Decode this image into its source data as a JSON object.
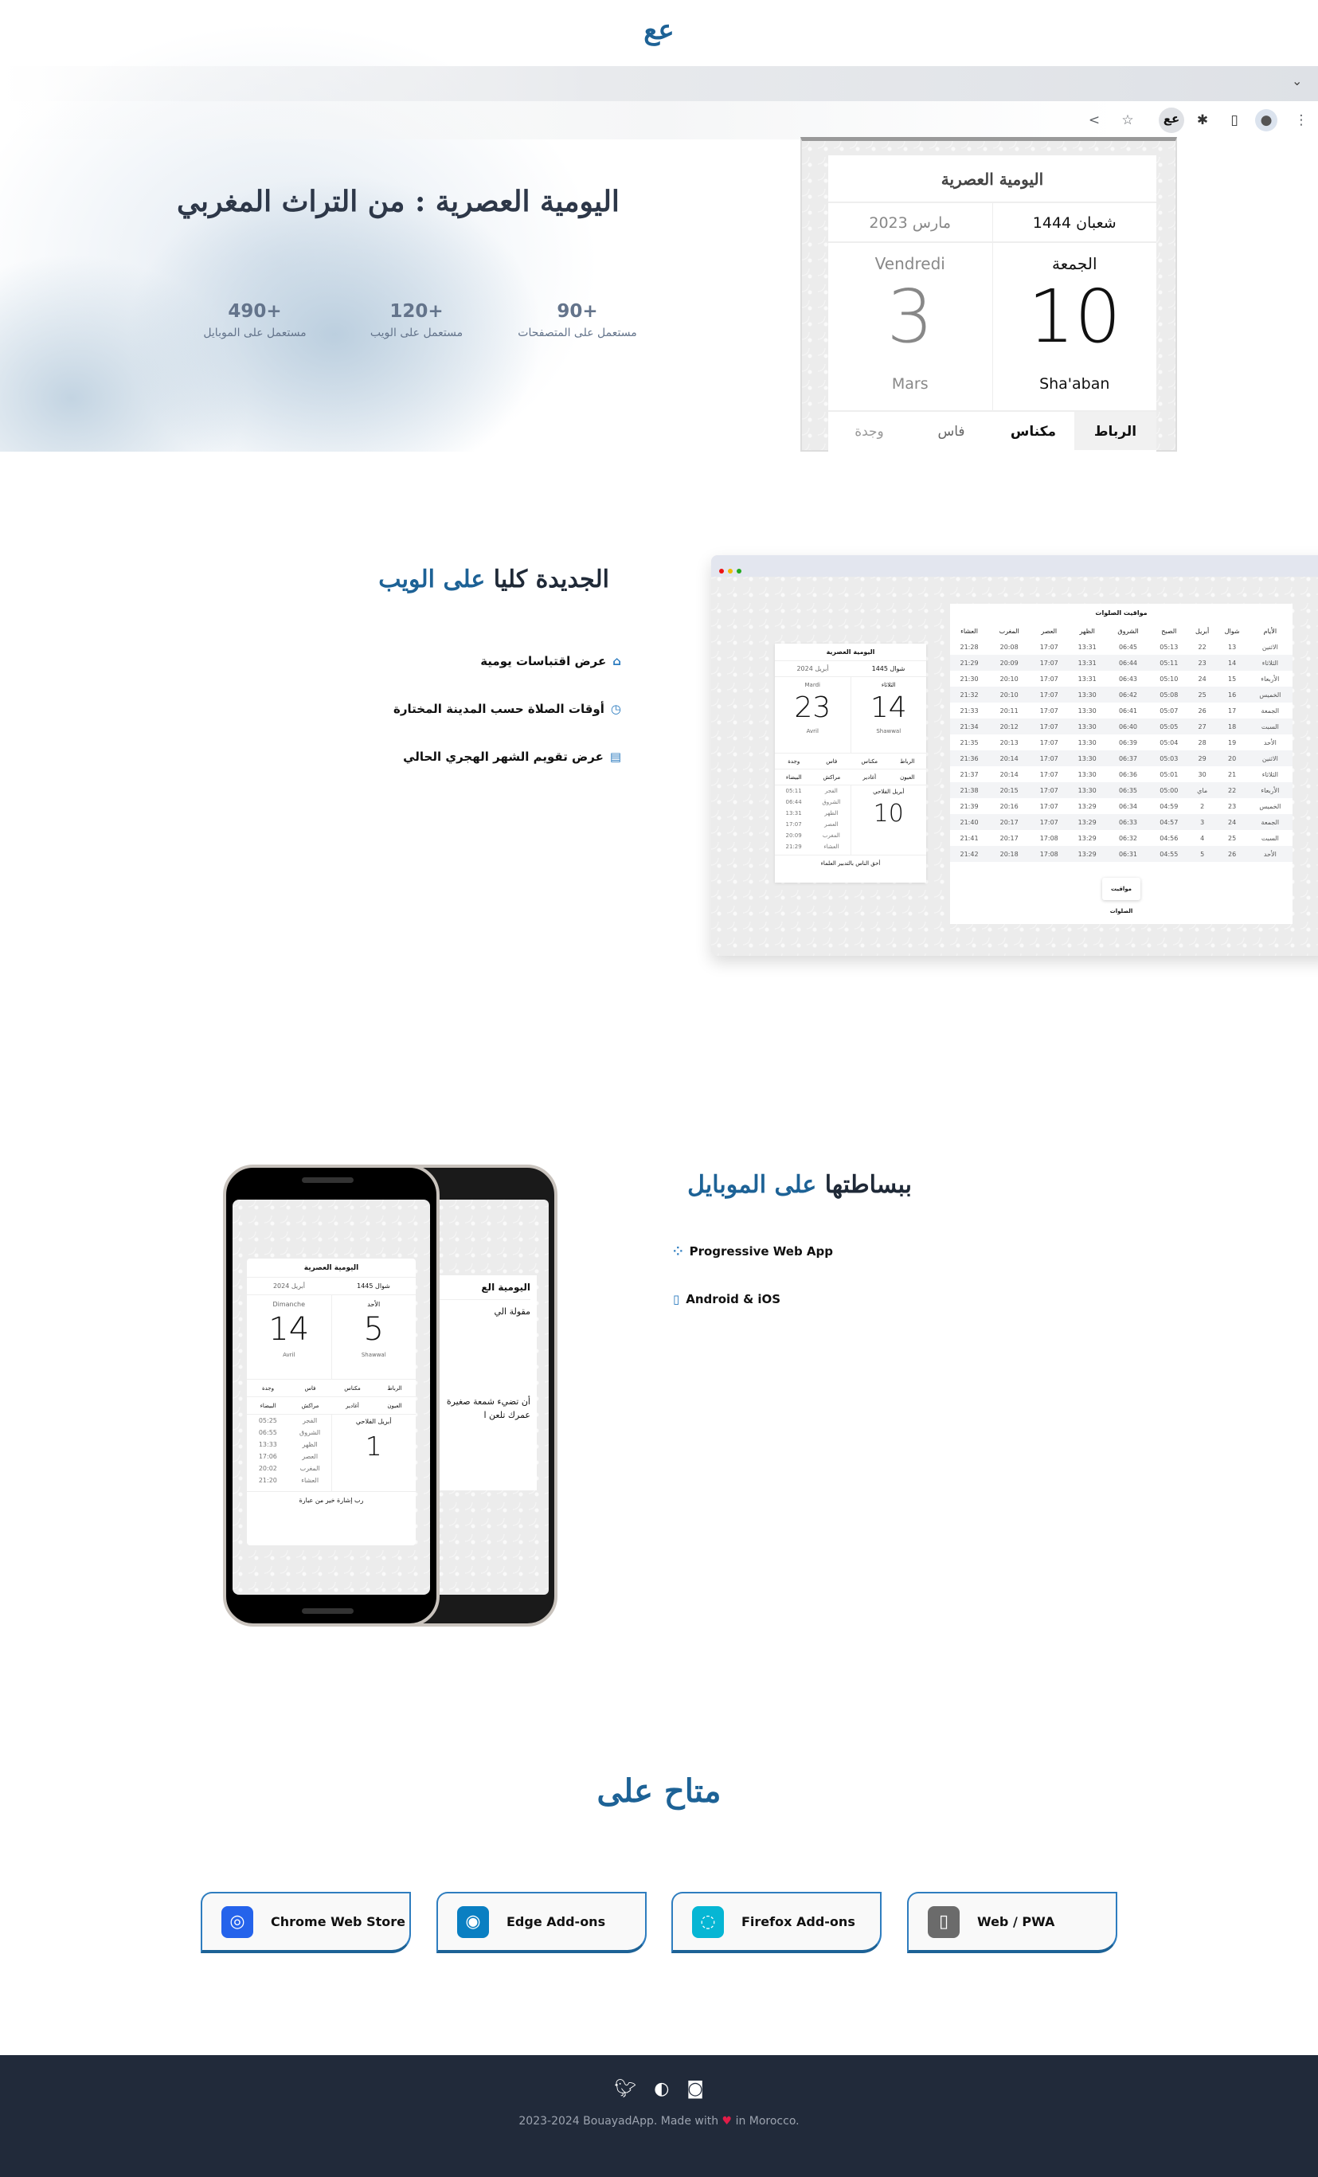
{
  "logo": "ﻋﻊ",
  "hero": {
    "title": "اليومية العصرية : من التراث المغربي",
    "stats": [
      {
        "value": "90+",
        "label": "مستعمل على المتصفحات"
      },
      {
        "value": "120+",
        "label": "مستعمل على الويب"
      },
      {
        "value": "490+",
        "label": "مستعمل على الموبايل"
      }
    ],
    "popup": {
      "title": "اليومية العصرية",
      "hijri": "شعبان 1444",
      "greg": "مارس 2023",
      "day_ar": "الجمعة",
      "day_fr": "Vendredi",
      "hijri_day": "10",
      "greg_day": "3",
      "hijri_month": "Sha'aban",
      "greg_month": "Mars",
      "cities": [
        "الرباط",
        "مكناس",
        "فاس",
        "وجدة"
      ]
    }
  },
  "browser_icons": [
    "share-icon",
    "star-icon",
    "extension-logo-icon",
    "puzzle-icon",
    "sidepanel-icon",
    "profile-icon",
    "menu-icon"
  ],
  "web": {
    "title_dark": "الجديدة كليا",
    "title_blue": "على الويب",
    "features": [
      {
        "icon": "inbox-icon",
        "label": "عرض اقتباسات يومية"
      },
      {
        "icon": "clock-icon",
        "label": "أوقات الصلاة حسب المدينة المختارة"
      },
      {
        "icon": "calendar-icon",
        "label": "عرض تقويم الشهر الهجري الحالي"
      }
    ],
    "card": {
      "title": "اليومية العصرية",
      "hijri": "شوال 1445",
      "greg": "أبريل 2024",
      "day_ar": "الثلاثاء",
      "day_fr": "Mardi",
      "hijri_day": "14",
      "greg_day": "23",
      "hijri_month": "Shawwal",
      "greg_month": "Avril",
      "cities1": [
        "الرباط",
        "مكناس",
        "فاس",
        "وجدة"
      ],
      "cities2": [
        "العيون",
        "أغادير",
        "مراكش",
        "البيضاء"
      ],
      "agri_label": "أبريل الفلاحي",
      "agri_day": "10",
      "prayers": [
        {
          "name": "الفجر",
          "time": "05:11"
        },
        {
          "name": "الشروق",
          "time": "06:44"
        },
        {
          "name": "الظهر",
          "time": "13:31"
        },
        {
          "name": "العصر",
          "time": "17:07"
        },
        {
          "name": "المغرب",
          "time": "20:09"
        },
        {
          "name": "العشاء",
          "time": "21:29"
        }
      ],
      "quote": "أحق الناس بالتدبير العلماء"
    },
    "table": {
      "title": "مواقيت الصلوات",
      "button": "مواقيت الصلوات",
      "headers": [
        "الأيام",
        "شوال",
        "أبريل",
        "الصبح",
        "الشروق",
        "الظهر",
        "العصر",
        "المغرب",
        "العشاء"
      ],
      "rows": [
        [
          "الاثنين",
          "13",
          "22",
          "05:13",
          "06:45",
          "13:31",
          "17:07",
          "20:08",
          "21:28"
        ],
        [
          "الثلاثاء",
          "14",
          "23",
          "05:11",
          "06:44",
          "13:31",
          "17:07",
          "20:09",
          "21:29"
        ],
        [
          "الأربعاء",
          "15",
          "24",
          "05:10",
          "06:43",
          "13:31",
          "17:07",
          "20:10",
          "21:30"
        ],
        [
          "الخميس",
          "16",
          "25",
          "05:08",
          "06:42",
          "13:30",
          "17:07",
          "20:10",
          "21:32"
        ],
        [
          "الجمعة",
          "17",
          "26",
          "05:07",
          "06:41",
          "13:30",
          "17:07",
          "20:11",
          "21:33"
        ],
        [
          "السبت",
          "18",
          "27",
          "05:05",
          "06:40",
          "13:30",
          "17:07",
          "20:12",
          "21:34"
        ],
        [
          "الأحد",
          "19",
          "28",
          "05:04",
          "06:39",
          "13:30",
          "17:07",
          "20:13",
          "21:35"
        ],
        [
          "الاثنين",
          "20",
          "29",
          "05:03",
          "06:37",
          "13:30",
          "17:07",
          "20:14",
          "21:36"
        ],
        [
          "الثلاثاء",
          "21",
          "30",
          "05:01",
          "06:36",
          "13:30",
          "17:07",
          "20:14",
          "21:37"
        ],
        [
          "الأربعاء",
          "22",
          "ماي",
          "05:00",
          "06:35",
          "13:30",
          "17:07",
          "20:15",
          "21:38"
        ],
        [
          "الخميس",
          "23",
          "2",
          "04:59",
          "06:34",
          "13:29",
          "17:07",
          "20:16",
          "21:39"
        ],
        [
          "الجمعة",
          "24",
          "3",
          "04:57",
          "06:33",
          "13:29",
          "17:07",
          "20:17",
          "21:40"
        ],
        [
          "السبت",
          "25",
          "4",
          "04:56",
          "06:32",
          "13:29",
          "17:08",
          "20:17",
          "21:41"
        ],
        [
          "الأحد",
          "26",
          "5",
          "04:55",
          "06:31",
          "13:29",
          "17:08",
          "20:18",
          "21:42"
        ]
      ]
    }
  },
  "mobile": {
    "title_dark": "ببساطتها",
    "title_blue": "على الموبايل",
    "features": [
      {
        "icon": "pwa-icon",
        "label": "Progressive Web App"
      },
      {
        "icon": "phone-icon",
        "label": "Android & iOS"
      }
    ],
    "card": {
      "title": "اليومية العصرية",
      "hijri": "شوال 1445",
      "greg": "أبريل 2024",
      "day_ar": "الأحد",
      "day_fr": "Dimanche",
      "hijri_day": "5",
      "greg_day": "14",
      "hijri_month": "Shawwal",
      "greg_month": "Avril",
      "cities1": [
        "الرباط",
        "مكناس",
        "فاس",
        "وجدة"
      ],
      "cities2": [
        "العيون",
        "أغادير",
        "مراكش",
        "البيضاء"
      ],
      "agri_label": "أبريل الفلاحي",
      "agri_day": "1",
      "prayers": [
        {
          "name": "الفجر",
          "time": "05:25"
        },
        {
          "name": "الشروق",
          "time": "06:55"
        },
        {
          "name": "الظهر",
          "time": "13:33"
        },
        {
          "name": "العصر",
          "time": "17:06"
        },
        {
          "name": "المغرب",
          "time": "20:02"
        },
        {
          "name": "العشاء",
          "time": "21:20"
        }
      ],
      "quote": "رب إشارة خير من عبارة"
    },
    "back_card": {
      "title": "اليومية الع",
      "quote_label": "مقولة الي",
      "line1": "أن تضيء شمعة صغيرة",
      "line2": "عمرك تلعن ا"
    }
  },
  "available": {
    "title": "متاح على",
    "stores": [
      {
        "label": "Chrome Web Store",
        "icon": "chrome-icon",
        "color": "#2563eb"
      },
      {
        "label": "Edge Add-ons",
        "icon": "edge-icon",
        "color": "#0a7fc2"
      },
      {
        "label": "Firefox Add-ons",
        "icon": "firefox-icon",
        "color": "#06b6d4"
      },
      {
        "label": "Web / PWA",
        "icon": "mobile-icon",
        "color": "#6b6b6b"
      }
    ]
  },
  "footer": {
    "icons": [
      "twitter-icon",
      "github-icon",
      "instagram-icon"
    ],
    "text_before": "2023-2024 BouayadApp. Made with",
    "text_after": "in Morocco."
  }
}
